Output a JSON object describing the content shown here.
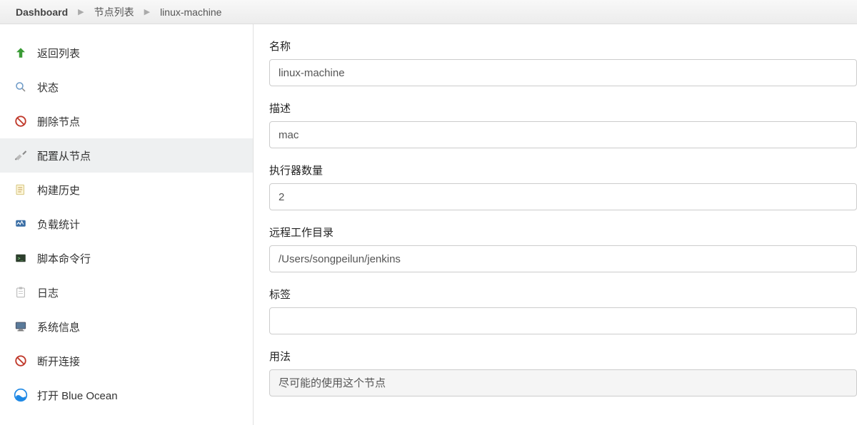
{
  "breadcrumb": {
    "items": [
      "Dashboard",
      "节点列表",
      "linux-machine"
    ]
  },
  "sidebar": {
    "items": [
      {
        "label": "返回列表"
      },
      {
        "label": "状态"
      },
      {
        "label": "删除节点"
      },
      {
        "label": "配置从节点"
      },
      {
        "label": "构建历史"
      },
      {
        "label": "负载统计"
      },
      {
        "label": "脚本命令行"
      },
      {
        "label": "日志"
      },
      {
        "label": "系统信息"
      },
      {
        "label": "断开连接"
      },
      {
        "label": "打开 Blue Ocean"
      }
    ]
  },
  "form": {
    "name": {
      "label": "名称",
      "value": "linux-machine"
    },
    "description": {
      "label": "描述",
      "value": "mac"
    },
    "executors": {
      "label": "执行器数量",
      "value": "2"
    },
    "remoteDir": {
      "label": "远程工作目录",
      "value": "/Users/songpeilun/jenkins"
    },
    "labels": {
      "label": "标签",
      "value": ""
    },
    "usage": {
      "label": "用法",
      "value": "尽可能的使用这个节点"
    }
  }
}
